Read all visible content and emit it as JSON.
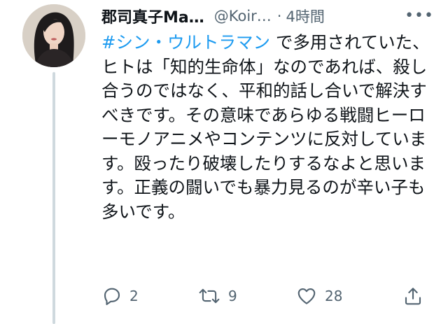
{
  "tweet": {
    "author_name": "郡司真子Ma…",
    "handle": "@Koir…",
    "separator": "·",
    "time": "4時間",
    "more_label": "•••",
    "hashtag": "#シン・ウルトラマン",
    "text_after_hashtag": " で多用されていた、ヒトは「知的生命体」なのであれば、殺し合うのではなく、平和的話し合いで解決すべきです。その意味であらゆる戦闘ヒーローモノアニメやコンテンツに反対しています。殴ったり破壊したりするなよと思います。正義の闘いでも暴力見るのが辛い子も多いです。"
  },
  "actions": {
    "reply_count": "2",
    "retweet_count": "9",
    "like_count": "28"
  },
  "icons": {
    "reply": "reply-icon",
    "retweet": "retweet-icon",
    "like": "heart-icon",
    "share": "share-icon",
    "more": "more-icon"
  }
}
